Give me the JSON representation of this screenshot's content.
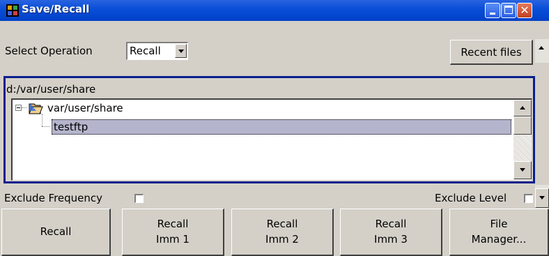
{
  "window": {
    "title": "Save/Recall",
    "accent": "#0a246a"
  },
  "operation": {
    "label": "Select Operation",
    "selected": "Recall"
  },
  "recent_files_label": "Recent files",
  "path_panel": {
    "path": "d:/var/user/share",
    "tree": [
      {
        "label": "var/user/share",
        "icon": "folder-open-icon",
        "level": 0
      },
      {
        "label": "testftp",
        "icon": "",
        "level": 1,
        "selected": true
      }
    ]
  },
  "options": {
    "exclude_frequency": {
      "label": "Exclude Frequency",
      "checked": false
    },
    "exclude_level": {
      "label": "Exclude Level",
      "checked": false
    }
  },
  "actions": [
    {
      "line1": "Recall",
      "line2": ""
    },
    {
      "line1": "Recall",
      "line2": "Imm 1"
    },
    {
      "line1": "Recall",
      "line2": "Imm 2"
    },
    {
      "line1": "Recall",
      "line2": "Imm 3"
    },
    {
      "line1": "File",
      "line2": "Manager..."
    }
  ]
}
